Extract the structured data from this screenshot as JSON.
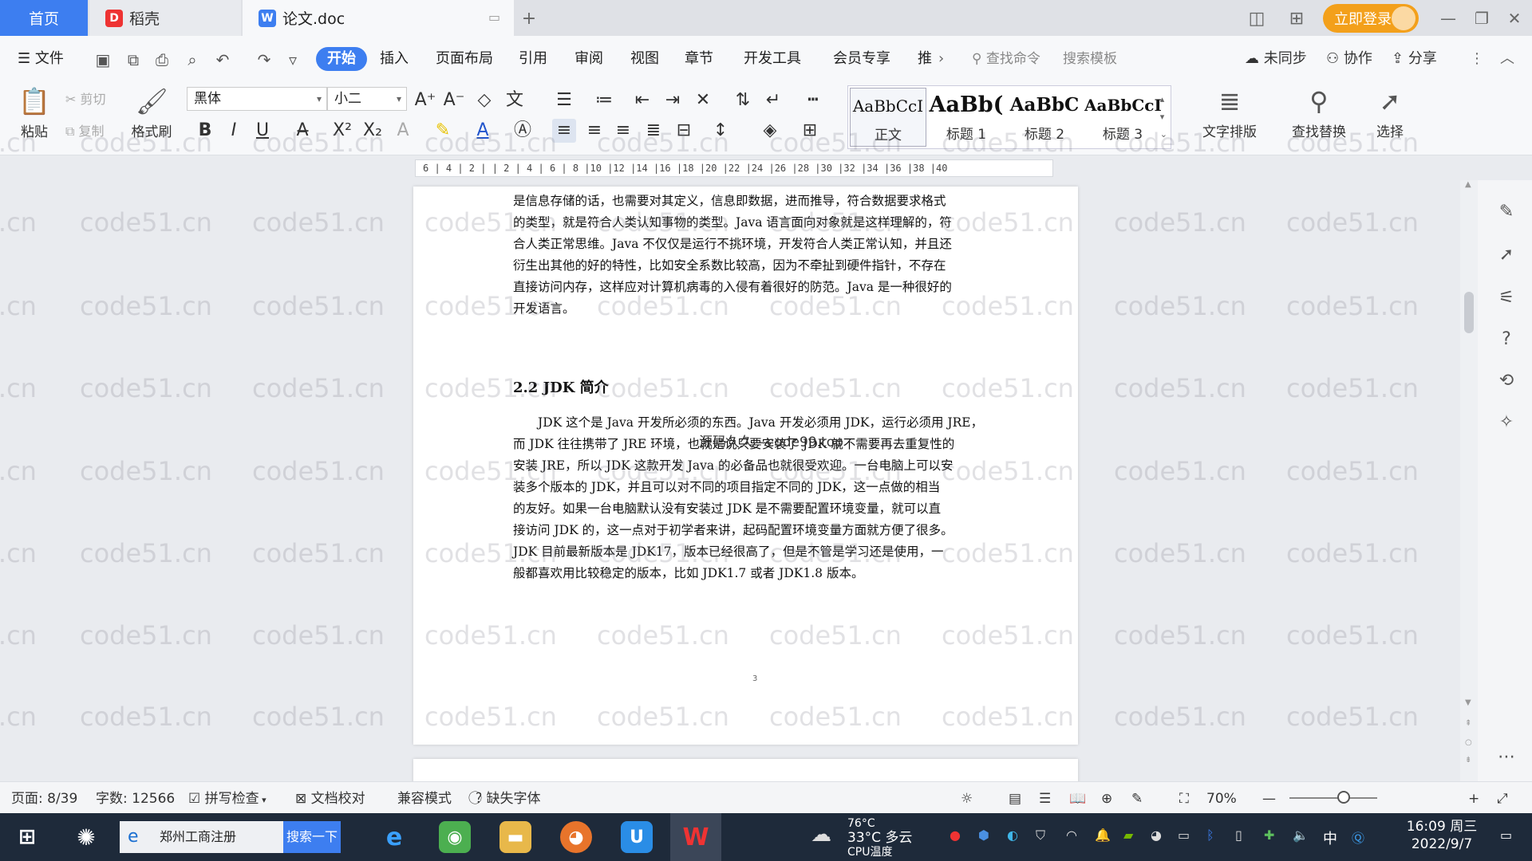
{
  "tabs": {
    "home": "首页",
    "daoke": "稻壳",
    "document": "论文.doc",
    "login": "立即登录"
  },
  "menu": {
    "file": "文件",
    "items": [
      "开始",
      "插入",
      "页面布局",
      "引用",
      "审阅",
      "视图",
      "章节",
      "开发工具",
      "会员专享",
      "推"
    ],
    "search_command": "查找命令",
    "search_template": "搜索模板",
    "not_synced": "未同步",
    "collaborate": "协作",
    "share": "分享"
  },
  "ribbon": {
    "paste": "粘贴",
    "cut": "剪切",
    "copy": "复制",
    "format_painter": "格式刷",
    "font_name": "黑体",
    "font_size": "小二",
    "styles": [
      {
        "preview": "AaBbCcI",
        "name": "正文"
      },
      {
        "preview": "AaBb(",
        "name": "标题 1"
      },
      {
        "preview": "AaBbC",
        "name": "标题 2"
      },
      {
        "preview": "AaBbCcI",
        "name": "标题 3"
      }
    ],
    "text_layout": "文字排版",
    "find_replace": "查找替换",
    "select": "选择"
  },
  "ruler": {
    "ticks": "6 | 4 | 2 |     | 2 | 4 | 6 | 8 |10 |12 |14 |16 |18 |20 |22 |24 |26 |28 |30 |32 |34 |36 |38 |40"
  },
  "document": {
    "lines_top": [
      "是信息存储的话，也需要对其定义，信息即数据，进而推导，符合数据要求格式",
      "的类型，就是符合人类认知事物的类型。Java 语言面向对象就是这样理解的，符",
      "合人类正常思维。Java 不仅仅是运行不挑环境，开发符合人类正常认知，并且还",
      "衍生出其他的好的特性，比如安全系数比较高，因为不牵扯到硬件指针，不存在",
      "直接访问内存，这样应对计算机病毒的入侵有着很好的防范。Java 是一种很好的",
      "开发语言。"
    ],
    "heading": "2.2 JDK 简介",
    "lines_body": [
      "　　JDK 这个是 Java 开发所必须的东西。Java 开发必须用 JDK，运行必须用 JRE，",
      "而 JDK 往往携带了 JRE 环境，也就是说只要安装了 JDK 就不需要再去重复性的",
      "安装 JRE，所以 JDK 这款开发 Java 的必备品也就很受欢迎。一台电脑上可以安",
      "装多个版本的 JDK，并且可以对不同的项目指定不同的 JDK，这一点做的相当",
      "的友好。如果一台电脑默认没有安装过 JDK 是不需要配置环境变量，就可以直",
      "接访问 JDK 的，这一点对于初学者来讲，起码配置环境变量方面就方便了很多。",
      "JDK 目前最新版本是 JDK17，版本已经很高了，但是不管是学习还是使用，一",
      "般都喜欢用比较稳定的版本，比如 JDK1.7 或者 JDK1.8 版本。"
    ],
    "page_number": "3",
    "overlay": "源码久久—code99.top"
  },
  "watermark": "code51.cn",
  "status": {
    "page": "页面: 8/39",
    "word_count": "字数: 12566",
    "spell_check": "拼写检查",
    "doc_proof": "文档校对",
    "compat_mode": "兼容模式",
    "missing_font": "缺失字体",
    "zoom": "70%"
  },
  "taskbar": {
    "search_text": "郑州工商注册",
    "search_button": "搜索一下",
    "weather_temp": "33°C 多云",
    "cpu_temp": "76°C",
    "cpu_label": "CPU温度",
    "ime": "中",
    "time": "16:09 周三",
    "date": "2022/9/7"
  },
  "colors": {
    "accent": "#3d7ef0",
    "login": "#f3a01b",
    "taskbar": "#1e2a3a"
  }
}
